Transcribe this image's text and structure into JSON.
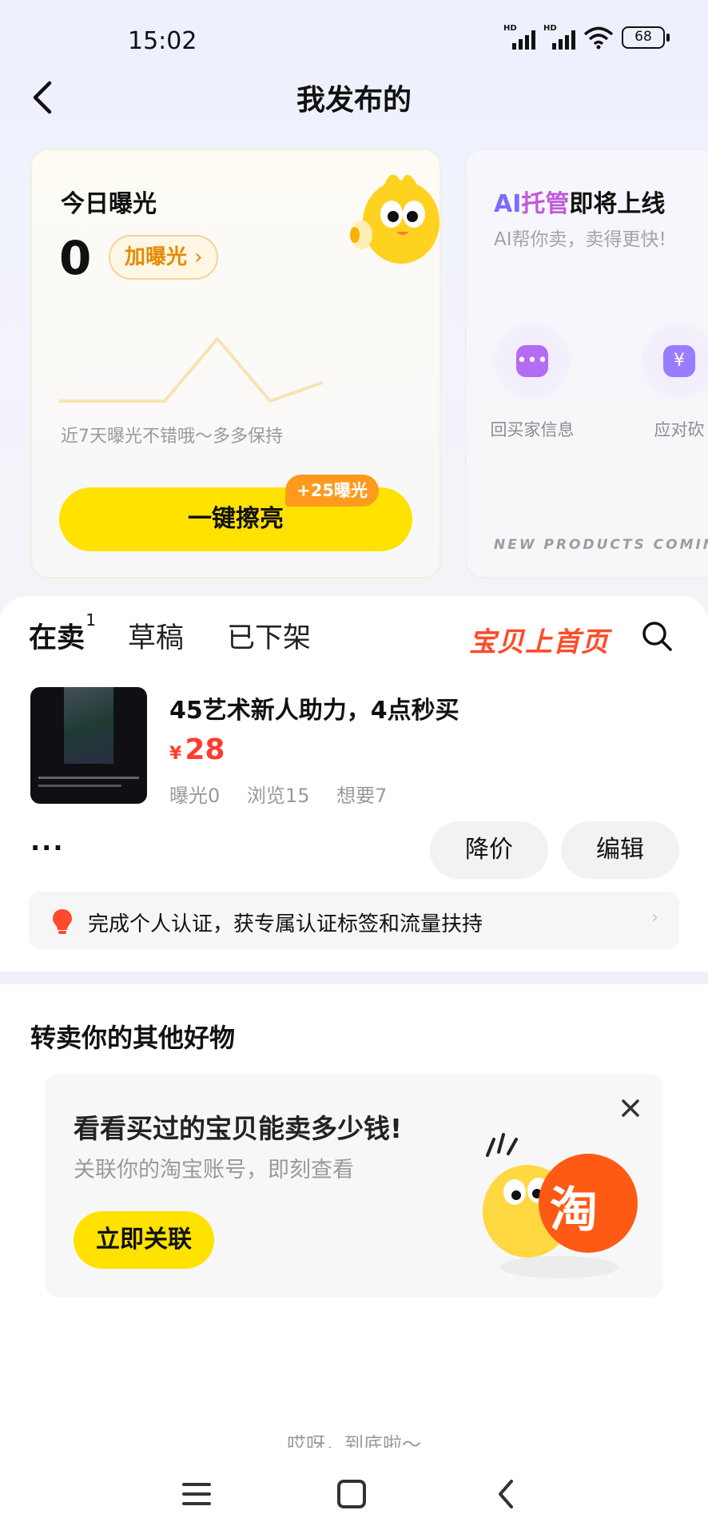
{
  "status_bar": {
    "time": "15:02",
    "network_1": "HD",
    "network_2": "HD",
    "battery": "68"
  },
  "header": {
    "title": "我发布的"
  },
  "exposure_card": {
    "label": "今日曝光",
    "value": "0",
    "boost_label": "加曝光",
    "trend": [
      0,
      0,
      0,
      1,
      0,
      0.3
    ],
    "note": "近7天曝光不错哦～多多保持",
    "action_label": "一键擦亮",
    "action_badge": "+25曝光"
  },
  "ai_card": {
    "title_prefix_a": "AI",
    "title_prefix_b": "托管",
    "title_suffix": "即将上线",
    "subtitle": "AI帮你卖，卖得更快!",
    "features": [
      {
        "label": "回买家信息",
        "icon": "chat-bubble-icon",
        "color": "#b46cf2"
      },
      {
        "label": "应对砍",
        "icon": "yen-icon",
        "color": "#9a7cff"
      }
    ],
    "footer": "NEW PRODUCTS COMING SOON"
  },
  "tabs": [
    {
      "label": "在卖",
      "count": "1"
    },
    {
      "label": "草稿"
    },
    {
      "label": "已下架"
    }
  ],
  "promo_label": "宝贝上首页",
  "listing": {
    "title": "45艺术新人助力，4点秒买",
    "currency": "¥",
    "price": "28",
    "stats": {
      "exposure": "曝光0",
      "views": "浏览15",
      "wants": "想要7"
    },
    "more_label": "···",
    "reduce_price_label": "降价",
    "edit_label": "编辑"
  },
  "verify_bar": {
    "text": "完成个人认证，获专属认证标签和流量扶持",
    "arrow": "›"
  },
  "resell": {
    "section_title": "转卖你的其他好物",
    "card_title": "看看买过的宝贝能卖多少钱!",
    "card_sub": "关联你的淘宝账号，即刻查看",
    "button_label": "立即关联",
    "logo_char": "淘"
  },
  "end_text": "哎呀，到底啦～",
  "colors": {
    "accent_yellow": "#ffe200",
    "price_red": "#ff3b2f",
    "promo_red": "#ff4b2b",
    "taobao_orange": "#ff5a14"
  }
}
